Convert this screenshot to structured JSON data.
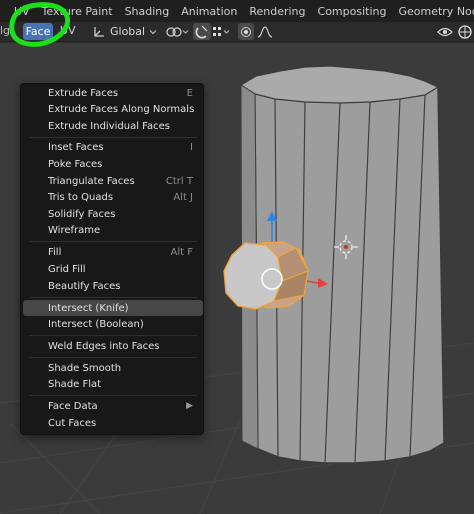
{
  "workspace_tabs": [
    "UV",
    "Texture Paint",
    "Shading",
    "Animation",
    "Rendering",
    "Compositing",
    "Geometry Nodes"
  ],
  "header": {
    "edge_stub": "lg",
    "face_menu": "Face",
    "uv_menu": "UV",
    "orientation": "Global"
  },
  "face_menu_items": [
    {
      "label": "Extrude Faces",
      "shortcut": "E"
    },
    {
      "label": "Extrude Faces Along Normals",
      "shortcut": ""
    },
    {
      "label": "Extrude Individual Faces",
      "shortcut": ""
    },
    {
      "label": "Inset Faces",
      "shortcut": "I"
    },
    {
      "label": "Poke Faces",
      "shortcut": ""
    },
    {
      "label": "Triangulate Faces",
      "shortcut": "Ctrl T"
    },
    {
      "label": "Tris to Quads",
      "shortcut": "Alt J"
    },
    {
      "label": "Solidify Faces",
      "shortcut": ""
    },
    {
      "label": "Wireframe",
      "shortcut": ""
    },
    {
      "label": "Fill",
      "shortcut": "Alt F"
    },
    {
      "label": "Grid Fill",
      "shortcut": ""
    },
    {
      "label": "Beautify Faces",
      "shortcut": ""
    },
    {
      "label": "Intersect (Knife)",
      "shortcut": ""
    },
    {
      "label": "Intersect (Boolean)",
      "shortcut": ""
    },
    {
      "label": "Weld Edges into Faces",
      "shortcut": ""
    },
    {
      "label": "Shade Smooth",
      "shortcut": ""
    },
    {
      "label": "Shade Flat",
      "shortcut": ""
    },
    {
      "label": "Face Data",
      "shortcut": ""
    },
    {
      "label": "Cut Faces",
      "shortcut": ""
    }
  ],
  "highlighted_item": "Intersect (Knife)",
  "colors": {
    "menu_active": "#4772b3",
    "annotation_green": "#19e019",
    "selection_orange": "#f2a43a",
    "axis_x": "#e2403e",
    "axis_y": "#7ecb1e",
    "axis_z": "#2f84e8"
  }
}
